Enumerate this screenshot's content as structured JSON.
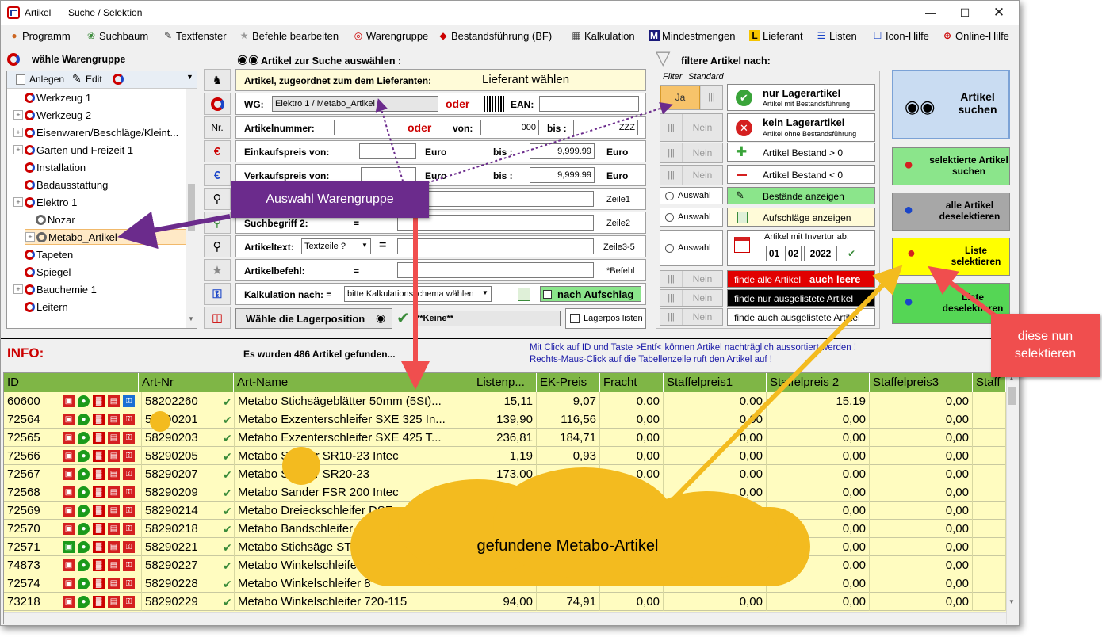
{
  "window": {
    "title": "Artikel",
    "subtitle": "Suche / Selektion"
  },
  "menu": [
    {
      "label": "Programm",
      "icon": "program-icon"
    },
    {
      "label": "Suchbaum",
      "icon": "tree-icon"
    },
    {
      "label": "Textfenster",
      "icon": "pencil-icon"
    },
    {
      "label": "Befehle bearbeiten",
      "icon": "star-icon"
    },
    {
      "label": "Warengruppe",
      "icon": "group-ring-icon"
    },
    {
      "label": "Bestandsführung (BF)",
      "icon": "stock-icon"
    },
    {
      "label": "Kalkulation",
      "icon": "calc-icon"
    },
    {
      "label": "Mindestmengen",
      "icon": "m-icon"
    },
    {
      "label": "Lieferant",
      "icon": "l-icon"
    },
    {
      "label": "Listen",
      "icon": "list-icon"
    },
    {
      "label": "Icon-Hilfe",
      "icon": "help-icon"
    },
    {
      "label": "Online-Hilfe",
      "icon": "lifebuoy-icon"
    }
  ],
  "left": {
    "header": "wähle Warengruppe",
    "toolbar": {
      "new": "Anlegen",
      "edit": "Edit"
    },
    "tree": [
      {
        "label": "Werkzeug 1",
        "level": 0,
        "expander": false,
        "icon": "ring"
      },
      {
        "label": "Werkzeug 2",
        "level": 0,
        "expander": true,
        "icon": "ring"
      },
      {
        "label": "Eisenwaren/Beschläge/Kleint...",
        "level": 0,
        "expander": true,
        "icon": "ring"
      },
      {
        "label": "Garten und Freizeit 1",
        "level": 0,
        "expander": true,
        "icon": "ring"
      },
      {
        "label": "Installation",
        "level": 0,
        "expander": false,
        "icon": "ring"
      },
      {
        "label": "Badausstattung",
        "level": 0,
        "expander": false,
        "icon": "ring"
      },
      {
        "label": "Elektro 1",
        "level": 0,
        "expander": true,
        "icon": "ring"
      },
      {
        "label": "Nozar",
        "level": 1,
        "expander": false,
        "icon": "ringg"
      },
      {
        "label": "Metabo_Artikel",
        "level": 1,
        "expander": true,
        "icon": "ringg",
        "selected": true
      },
      {
        "label": "Tapeten",
        "level": 0,
        "expander": false,
        "icon": "ring"
      },
      {
        "label": "Spiegel",
        "level": 0,
        "expander": false,
        "icon": "ring"
      },
      {
        "label": "Bauchemie 1",
        "level": 0,
        "expander": true,
        "icon": "ring"
      },
      {
        "label": "Leitern",
        "level": 0,
        "expander": false,
        "icon": "ring"
      }
    ]
  },
  "search": {
    "header": "Artikel zur Suche auswählen :",
    "supplier_label": "Artikel, zugeordnet zum dem Lieferanten:",
    "supplier_value": "Lieferant wählen",
    "wg_label": "WG:",
    "wg_value": "Elektro 1 / Metabo_Artikel",
    "or": "oder",
    "ean_label": "EAN:",
    "artnr_label": "Artikelnummer:",
    "von": "von:",
    "von_value": "000",
    "bis": "bis :",
    "bis_value": "ZZZ",
    "ek_label": "Einkaufspreis  von:",
    "vk_label": "Verkaufspreis  von:",
    "euro": "Euro",
    "bis2": "bis :",
    "price_to": "9,999.99",
    "zeile1": "Zeile1",
    "such2_label": "Suchbegriff 2:",
    "eq": "=",
    "zeile2": "Zeile2",
    "artikeltext_label": "Artikeltext:",
    "artikeltext_select": "Textzeile ?",
    "zeile35": "Zeile3-5",
    "befehl_label": "Artikelbefehl:",
    "befehl_hint": "*Befehl",
    "kalk_label": "Kalkulation nach: =",
    "kalk_select": "bitte Kalkulationsschema wählen",
    "nach_aufschlag": "nach Aufschlag",
    "lager_btn": "Wähle die Lagerposition",
    "keine": "**Keine**",
    "lagerpos": "Lagerpos listen"
  },
  "filter": {
    "header": "filtere Artikel nach:",
    "col_filter": "Filter",
    "col_standard": "Standard",
    "ja": "Ja",
    "nein": "Nein",
    "auswahl": "Auswahl",
    "nur_lager": "nur Lagerartikel",
    "nur_lager_sub": "Artikel mit Bestandsführung",
    "kein_lager": "kein Lagerartikel",
    "kein_lager_sub": "Artikel ohne Bestandsführung",
    "bestand_gt": "Artikel Bestand > 0",
    "bestand_lt": "Artikel Bestand < 0",
    "bestaende": "Bestände anzeigen",
    "aufschlaege": "Aufschläge anzeigen",
    "invertur": "Artikel mit Invertur ab:",
    "day": "01",
    "month": "02",
    "year": "2022",
    "alle_leere_a": "finde alle Artikel",
    "alle_leere_b": "auch leere",
    "nur_ausgelistet": "finde nur ausgelistete Artikel",
    "auch_ausgelistet": "finde auch ausgelistete Artikel"
  },
  "actions": {
    "suchen": "Artikel suchen",
    "selektierte": "selektierte Artikel suchen",
    "alle_desel": "alle Artikel deselektieren",
    "liste_sel": "Liste selektieren",
    "liste_desel": "Liste deselektieren"
  },
  "info": {
    "label": "INFO:",
    "found": "Es wurden 486 Artikel gefunden...",
    "hint1": "Mit Click auf ID und Taste >Entf< können Artikel nachträglich aussortiert werden !",
    "hint2": "Rechts-Maus-Click auf die Tabellenzeile ruft den Artikel auf !"
  },
  "table": {
    "columns": [
      "ID",
      "Art-Nr",
      "Art-Name",
      "Listenp...",
      "EK-Preis",
      "Fracht",
      "Staffelpreis1",
      "Staffelpreis 2",
      "Staffelpreis3",
      "Staff"
    ],
    "rows": [
      {
        "id": "60600",
        "artnr": "58202260",
        "name": "Metabo Stichsägeblätter 50mm (5St)...",
        "list": "15,11",
        "ek": "9,07",
        "fracht": "0,00",
        "s1": "0,00",
        "s2": "15,19",
        "s3": "0,00",
        "ic": "b"
      },
      {
        "id": "72564",
        "artnr": "58290201",
        "name": "Metabo Exzenterschleifer SXE 325 In...",
        "list": "139,90",
        "ek": "116,56",
        "fracht": "0,00",
        "s1": "0,00",
        "s2": "0,00",
        "s3": "0,00",
        "ic": "r"
      },
      {
        "id": "72565",
        "artnr": "58290203",
        "name": "Metabo Exzenterschleifer SXE 425 T...",
        "list": "236,81",
        "ek": "184,71",
        "fracht": "0,00",
        "s1": "0,00",
        "s2": "0,00",
        "s3": "0,00",
        "ic": "r"
      },
      {
        "id": "72566",
        "artnr": "58290205",
        "name": "Metabo Sander SR10-23 Intec",
        "list": "1,19",
        "ek": "0,93",
        "fracht": "0,00",
        "s1": "0,00",
        "s2": "0,00",
        "s3": "0,00",
        "ic": "r"
      },
      {
        "id": "72567",
        "artnr": "58290207",
        "name": "Metabo Sander SR20-23",
        "list": "173,00",
        "ek": "138,75",
        "fracht": "0,00",
        "s1": "0,00",
        "s2": "0,00",
        "s3": "0,00",
        "ic": "r"
      },
      {
        "id": "72568",
        "artnr": "58290209",
        "name": "Metabo Sander FSR 200 Intec",
        "list": "",
        "ek": "",
        "fracht": "",
        "s1": "0,00",
        "s2": "0,00",
        "s3": "0,00",
        "ic": "r"
      },
      {
        "id": "72569",
        "artnr": "58290214",
        "name": "Metabo Dreieckschleifer DSE",
        "list": "",
        "ek": "",
        "fracht": "",
        "s1": "",
        "s2": "0,00",
        "s3": "0,00",
        "ic": "r"
      },
      {
        "id": "72570",
        "artnr": "58290218",
        "name": "Metabo Bandschleifer BaE 75",
        "list": "",
        "ek": "",
        "fracht": "",
        "s1": "",
        "s2": "0,00",
        "s3": "0,00",
        "ic": "r"
      },
      {
        "id": "72571",
        "artnr": "58290221",
        "name": "Metabo Stichsäge STE",
        "list": "",
        "ek": "",
        "fracht": "",
        "s1": "",
        "s2": "0,00",
        "s3": "0,00",
        "ic": "g"
      },
      {
        "id": "74873",
        "artnr": "58290227",
        "name": "Metabo Winkelschleifer",
        "list": "",
        "ek": "",
        "fracht": "",
        "s1": "",
        "s2": "0,00",
        "s3": "0,00",
        "ic": "r"
      },
      {
        "id": "72574",
        "artnr": "58290228",
        "name": "Metabo Winkelschleifer 8",
        "list": "",
        "ek": "",
        "fracht": "",
        "s1": "",
        "s2": "0,00",
        "s3": "0,00",
        "ic": "r"
      },
      {
        "id": "73218",
        "artnr": "58290229",
        "name": "Metabo Winkelschleifer 720-115",
        "list": "94,00",
        "ek": "74,91",
        "fracht": "0,00",
        "s1": "0,00",
        "s2": "0,00",
        "s3": "0,00",
        "ic": "r"
      }
    ]
  },
  "callouts": {
    "warengruppe": "Auswahl Warengruppe",
    "cloud": "gefundene Metabo-Artikel",
    "selektieren": "diese nun selektieren"
  },
  "colors": {
    "menu_green": "#7fb646",
    "grid_bg": "#fffcc0",
    "callout_purple": "#6b2b8c",
    "callout_red": "#f04e4e",
    "cloud_yellow": "#f3bb1f"
  }
}
